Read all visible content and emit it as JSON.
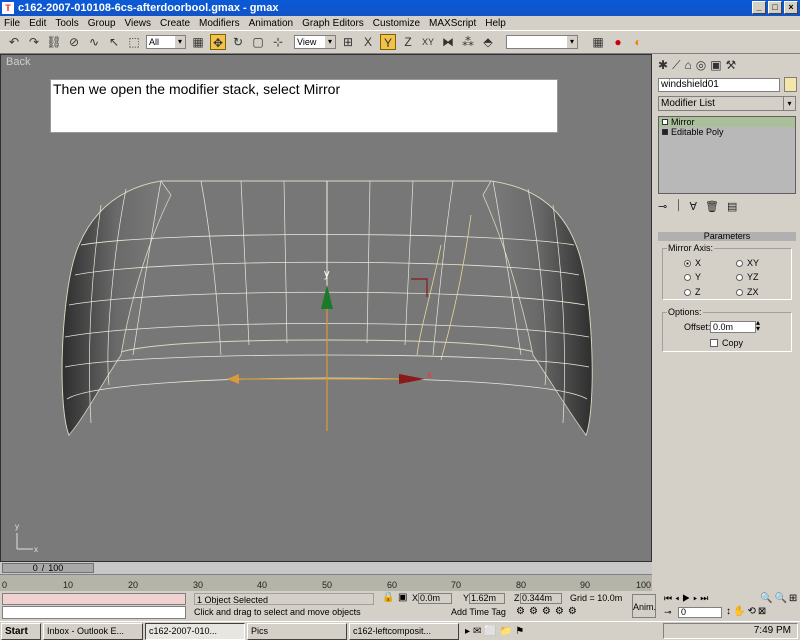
{
  "window": {
    "title": "c162-2007-010108-6cs-afterdoorbool.gmax - gmax",
    "controls": [
      "_",
      "□",
      "×"
    ]
  },
  "menu": [
    "File",
    "Edit",
    "Tools",
    "Group",
    "Views",
    "Create",
    "Modifiers",
    "Animation",
    "Graph Editors",
    "Customize",
    "MAXScript",
    "Help"
  ],
  "toolbar": {
    "selection_filter": "All",
    "reference_coord": "View"
  },
  "viewport": {
    "label": "Back",
    "instruction": "Then we open the modifier stack, select Mirror",
    "axis_y": "y",
    "axis_x": "x",
    "corner_axis_y": "y",
    "corner_axis_x": "x"
  },
  "panel": {
    "object_name": "windshield01",
    "modifier_list": "Modifier List",
    "stack": [
      "Mirror",
      "Editable Poly"
    ],
    "rollout_title": "Parameters",
    "mirror_axis_label": "Mirror Axis:",
    "axes": [
      "X",
      "XY",
      "Y",
      "YZ",
      "Z",
      "ZX"
    ],
    "options_label": "Options:",
    "offset_label": "Offset:",
    "offset_value": "0.0m",
    "copy_label": "Copy"
  },
  "timeline": {
    "position": "0",
    "total": "100",
    "ticks": [
      "0",
      "10",
      "20",
      "30",
      "40",
      "50",
      "60",
      "70",
      "80",
      "90",
      "100"
    ]
  },
  "status": {
    "selected": "1 Object Selected",
    "prompt": "Click and drag to select and move objects",
    "x_value": "0.0m",
    "y_value": "1.62m",
    "z_value": "0.344m",
    "grid": "Grid = 10.0m",
    "time_tag": "Add Time Tag",
    "anim": "Anim.",
    "frame": "0"
  },
  "taskbar": {
    "start": "Start",
    "tasks": [
      "Inbox - Outlook E...",
      "c162-2007-010...",
      "Pics",
      "c162-leftcomposit..."
    ],
    "clock": "7:49 PM"
  }
}
